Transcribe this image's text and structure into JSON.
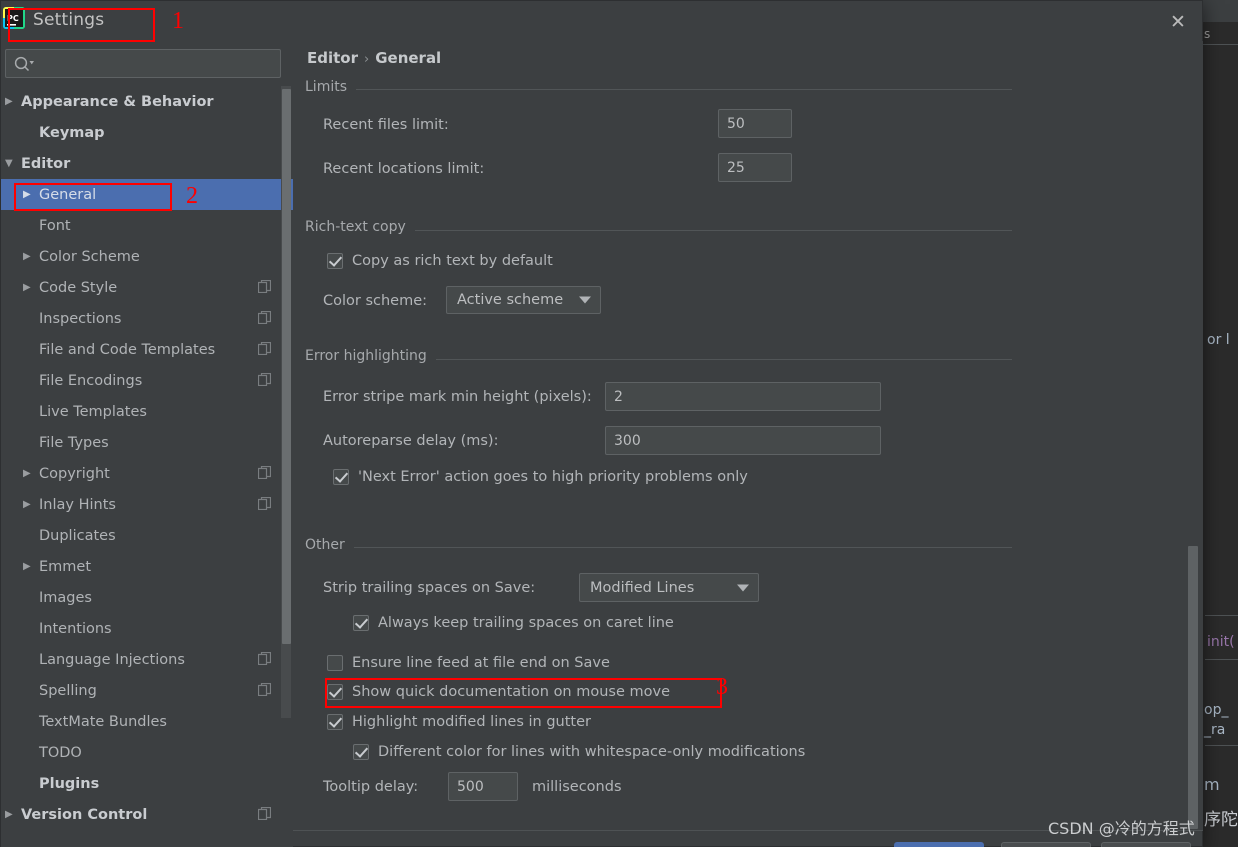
{
  "window": {
    "title": "Settings",
    "app_icon": "pycharm-logo-icon",
    "close_icon": "close-icon"
  },
  "search": {
    "value": "",
    "placeholder": "",
    "icon": "search-icon"
  },
  "sidebar": {
    "scroll_icon": "scrollbar",
    "items": [
      {
        "label": "Appearance & Behavior",
        "arrow": "▶",
        "indent": 0,
        "bold": true,
        "selected": false,
        "badge": false
      },
      {
        "label": "Keymap",
        "arrow": "",
        "indent": 1,
        "bold": true,
        "selected": false,
        "badge": false
      },
      {
        "label": "Editor",
        "arrow": "▼",
        "indent": 0,
        "bold": true,
        "selected": false,
        "badge": false
      },
      {
        "label": "General",
        "arrow": "▶",
        "indent": 1,
        "bold": false,
        "selected": true,
        "badge": false
      },
      {
        "label": "Font",
        "arrow": "",
        "indent": 1,
        "bold": false,
        "selected": false,
        "badge": false
      },
      {
        "label": "Color Scheme",
        "arrow": "▶",
        "indent": 1,
        "bold": false,
        "selected": false,
        "badge": false
      },
      {
        "label": "Code Style",
        "arrow": "▶",
        "indent": 1,
        "bold": false,
        "selected": false,
        "badge": true
      },
      {
        "label": "Inspections",
        "arrow": "",
        "indent": 1,
        "bold": false,
        "selected": false,
        "badge": true
      },
      {
        "label": "File and Code Templates",
        "arrow": "",
        "indent": 1,
        "bold": false,
        "selected": false,
        "badge": true
      },
      {
        "label": "File Encodings",
        "arrow": "",
        "indent": 1,
        "bold": false,
        "selected": false,
        "badge": true
      },
      {
        "label": "Live Templates",
        "arrow": "",
        "indent": 1,
        "bold": false,
        "selected": false,
        "badge": false
      },
      {
        "label": "File Types",
        "arrow": "",
        "indent": 1,
        "bold": false,
        "selected": false,
        "badge": false
      },
      {
        "label": "Copyright",
        "arrow": "▶",
        "indent": 1,
        "bold": false,
        "selected": false,
        "badge": true
      },
      {
        "label": "Inlay Hints",
        "arrow": "▶",
        "indent": 1,
        "bold": false,
        "selected": false,
        "badge": true
      },
      {
        "label": "Duplicates",
        "arrow": "",
        "indent": 1,
        "bold": false,
        "selected": false,
        "badge": false
      },
      {
        "label": "Emmet",
        "arrow": "▶",
        "indent": 1,
        "bold": false,
        "selected": false,
        "badge": false
      },
      {
        "label": "Images",
        "arrow": "",
        "indent": 1,
        "bold": false,
        "selected": false,
        "badge": false
      },
      {
        "label": "Intentions",
        "arrow": "",
        "indent": 1,
        "bold": false,
        "selected": false,
        "badge": false
      },
      {
        "label": "Language Injections",
        "arrow": "",
        "indent": 1,
        "bold": false,
        "selected": false,
        "badge": true
      },
      {
        "label": "Spelling",
        "arrow": "",
        "indent": 1,
        "bold": false,
        "selected": false,
        "badge": true
      },
      {
        "label": "TextMate Bundles",
        "arrow": "",
        "indent": 1,
        "bold": false,
        "selected": false,
        "badge": false
      },
      {
        "label": "TODO",
        "arrow": "",
        "indent": 1,
        "bold": false,
        "selected": false,
        "badge": false
      },
      {
        "label": "Plugins",
        "arrow": "",
        "indent": 1,
        "bold": true,
        "selected": false,
        "badge": false
      },
      {
        "label": "Version Control",
        "arrow": "▶",
        "indent": 0,
        "bold": true,
        "selected": false,
        "badge": true
      }
    ]
  },
  "breadcrumb": {
    "parent": "Editor",
    "separator": "›",
    "current": "General"
  },
  "sections": {
    "limits": {
      "title": "Limits",
      "recent_files_label": "Recent files limit:",
      "recent_files_value": "50",
      "recent_locations_label": "Recent locations limit:",
      "recent_locations_value": "25"
    },
    "rich_text_copy": {
      "title": "Rich-text copy",
      "copy_rich_label": "Copy as rich text by default",
      "copy_rich_checked": true,
      "color_scheme_label": "Color scheme:",
      "color_scheme_value": "Active scheme"
    },
    "error_highlighting": {
      "title": "Error highlighting",
      "stripe_label": "Error stripe mark min height (pixels):",
      "stripe_value": "2",
      "autoreparse_label": "Autoreparse delay (ms):",
      "autoreparse_value": "300",
      "next_error_label": "'Next Error' action goes to high priority problems only",
      "next_error_checked": true
    },
    "other": {
      "title": "Other",
      "strip_label": "Strip trailing spaces on Save:",
      "strip_value": "Modified Lines",
      "keep_trailing_label": "Always keep trailing spaces on caret line",
      "keep_trailing_checked": true,
      "ensure_lf_label": "Ensure line feed at file end on Save",
      "ensure_lf_checked": false,
      "quick_doc_label": "Show quick documentation on mouse move",
      "quick_doc_checked": true,
      "highlight_gutter_label": "Highlight modified lines in gutter",
      "highlight_gutter_checked": true,
      "diff_color_label": "Different color for lines with whitespace-only modifications",
      "diff_color_checked": true,
      "tooltip_delay_label": "Tooltip delay:",
      "tooltip_delay_value": "500",
      "tooltip_delay_unit": "milliseconds"
    }
  },
  "annotations": [
    {
      "num": "1"
    },
    {
      "num": "2"
    },
    {
      "num": "3"
    }
  ],
  "background": {
    "tab_fragment": "s",
    "text_fragment": "or l",
    "code_line_1": "init(",
    "code_line_2": "op_",
    "code_line_3": "_ra",
    "code_line_4": "m ",
    "code_line_5": "序陀"
  },
  "watermark": {
    "text": "CSDN @冷的方程式"
  },
  "colors": {
    "accent": "#4b6eaf",
    "panel": "#3c3f41",
    "input": "#45494a",
    "text": "#b2b5b8",
    "annotation": "#ff0000"
  }
}
